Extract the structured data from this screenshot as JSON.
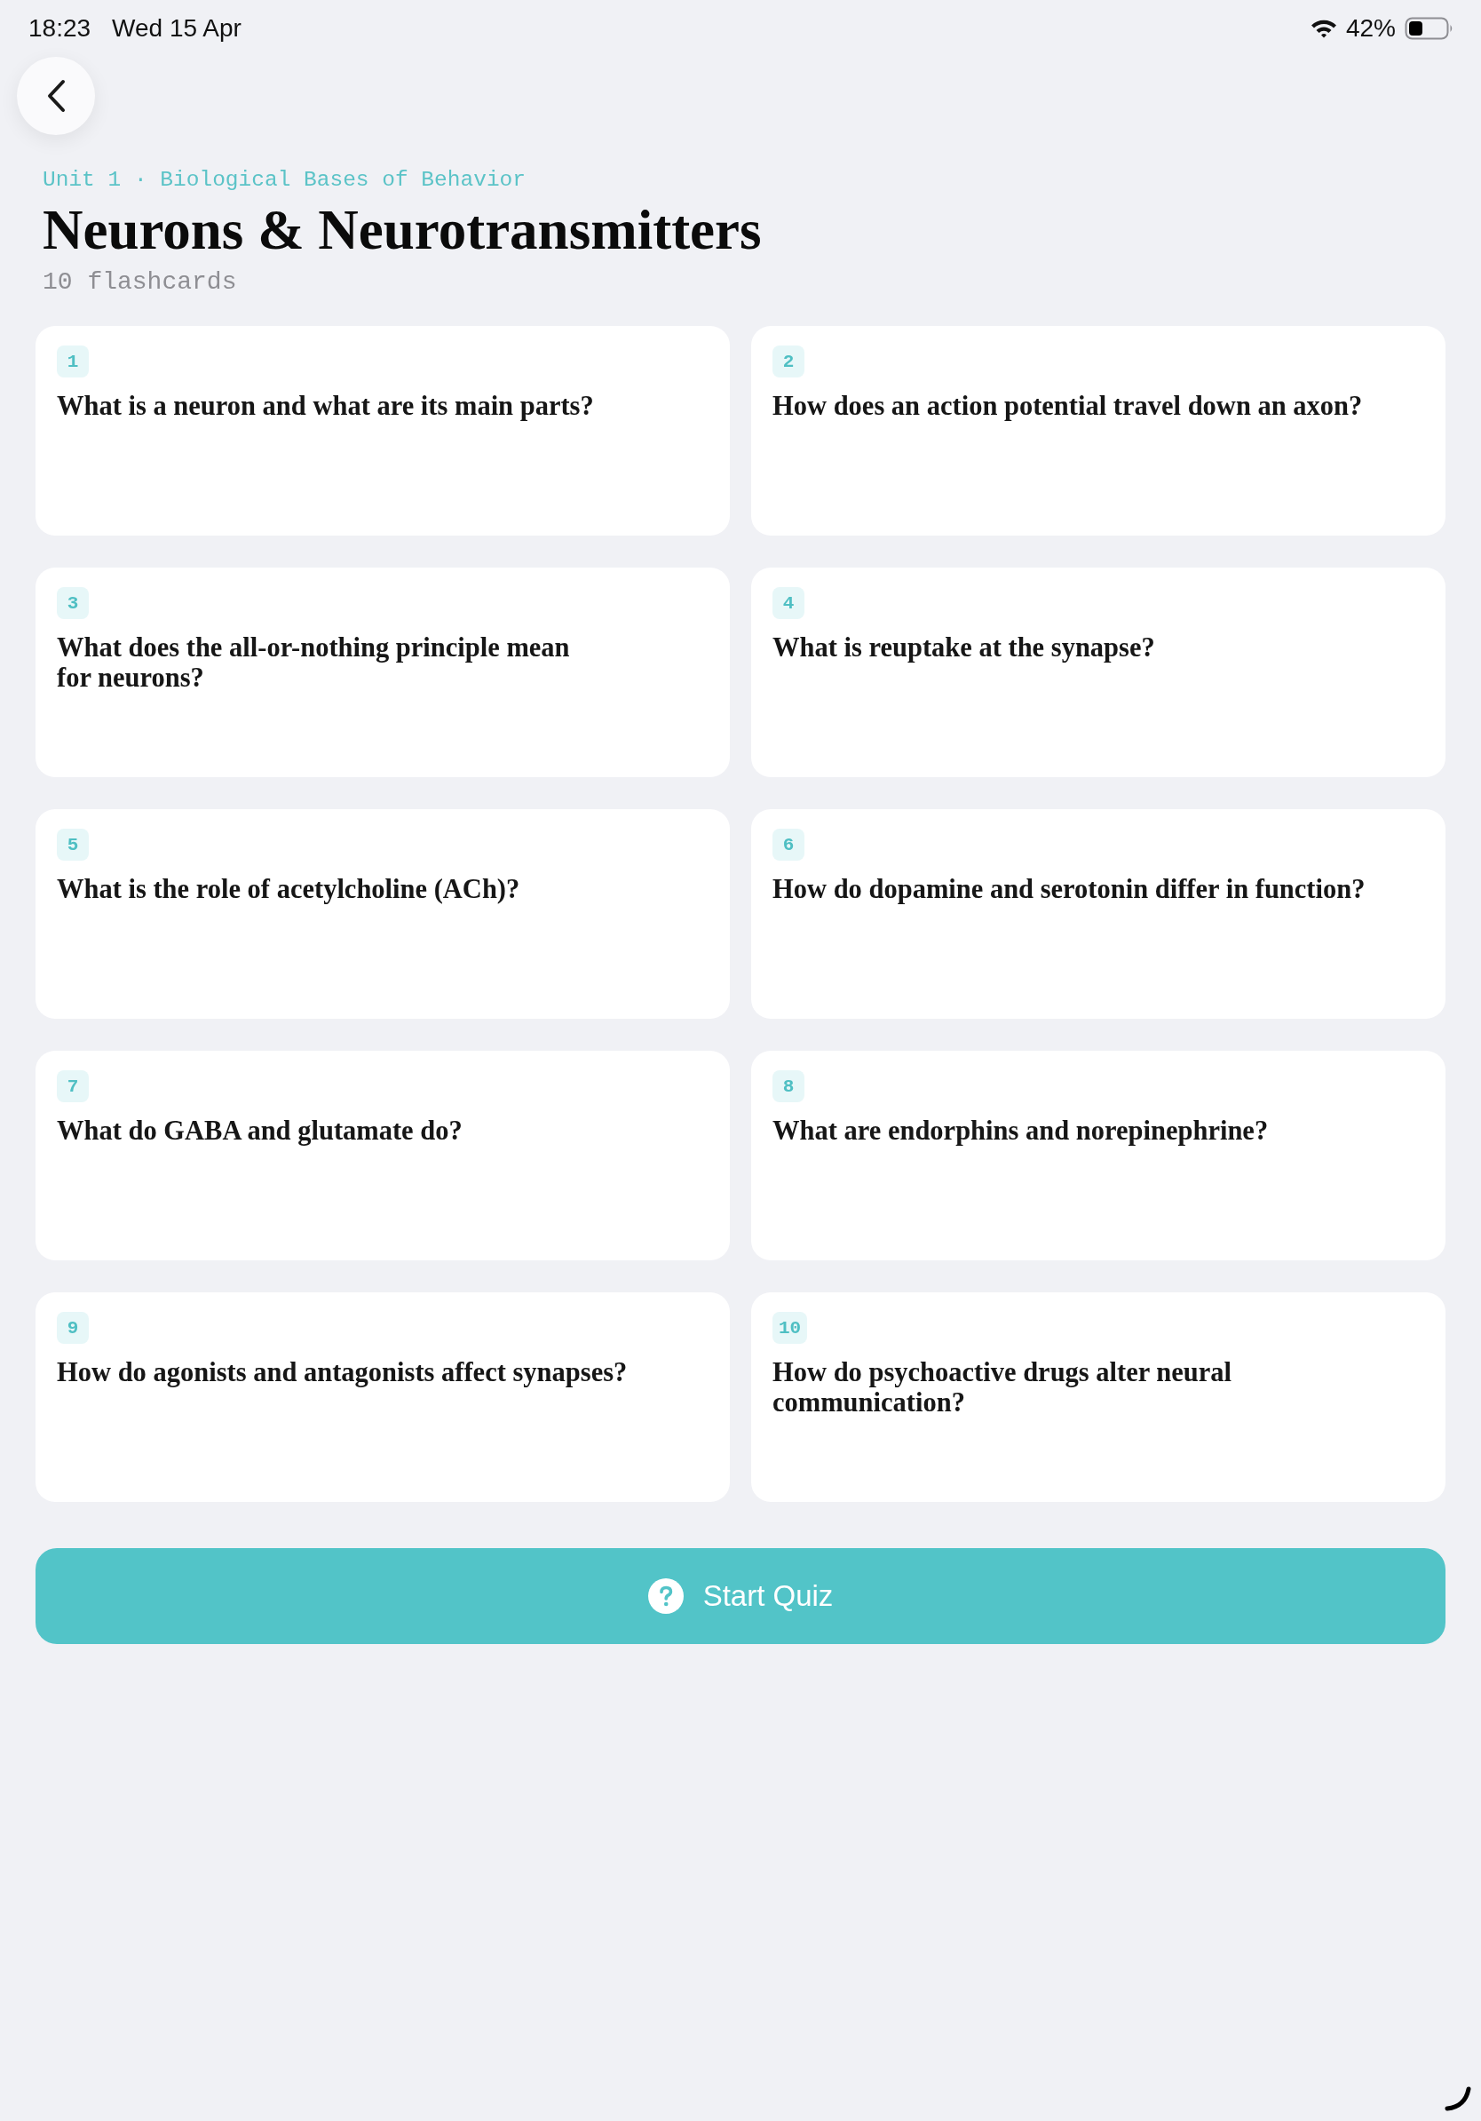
{
  "status_bar": {
    "time": "18:23",
    "date": "Wed 15 Apr",
    "battery": "42%"
  },
  "header": {
    "breadcrumb": "Unit 1 · Biological Bases of Behavior",
    "title": "Neurons & Neurotransmitters",
    "subtitle": "10 flashcards"
  },
  "flashcards": [
    {
      "number": "1",
      "question": "What is a neuron and what are its main parts?"
    },
    {
      "number": "2",
      "question": "How does an action potential travel down an axon?"
    },
    {
      "number": "3",
      "question": "What does the all-or-nothing principle mean\nfor neurons?"
    },
    {
      "number": "4",
      "question": "What is reuptake at the synapse?"
    },
    {
      "number": "5",
      "question": "What is the role of acetylcholine (ACh)?"
    },
    {
      "number": "6",
      "question": "How do dopamine and serotonin differ in function?"
    },
    {
      "number": "7",
      "question": "What do GABA and glutamate do?"
    },
    {
      "number": "8",
      "question": "What are endorphins and norepinephrine?"
    },
    {
      "number": "9",
      "question": "How do agonists and antagonists affect synapses?"
    },
    {
      "number": "10",
      "question": "How do psychoactive drugs alter neural\ncommunication?"
    }
  ],
  "start_button": {
    "label": "Start Quiz"
  }
}
